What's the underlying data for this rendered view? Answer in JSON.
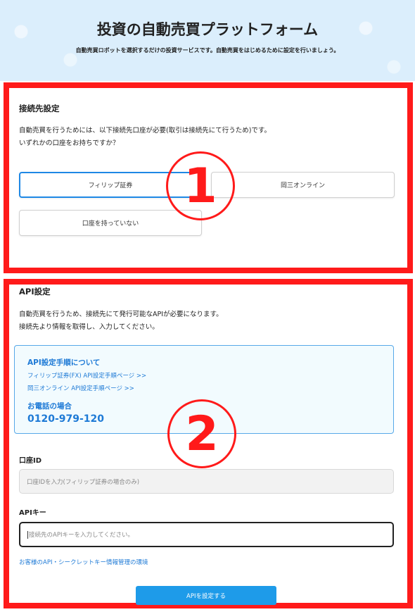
{
  "header": {
    "title": "投資の自動売買プラットフォーム",
    "subtitle": "自動売買ロボットを選択するだけの投資サービスです。自動売買をはじめるために設定を行いましょう。"
  },
  "connection": {
    "title": "接続先設定",
    "desc_line1": "自動売買を行うためには、以下接続先口座が必要(取引は接続先にて行うため)です。",
    "desc_line2": "いずれかの口座をお持ちですか？",
    "options": [
      {
        "label": "フィリップ証券",
        "selected": true
      },
      {
        "label": "岡三オンライン",
        "selected": false
      },
      {
        "label": "口座を持っていない",
        "selected": false
      }
    ],
    "marker": "1"
  },
  "api": {
    "title": "API設定",
    "desc_line1": "自動売買を行うため、接続先にて発行可能なAPIが必要になります。",
    "desc_line2": "接続先より情報を取得し、入力してください。",
    "info": {
      "title": "API設定手順について",
      "link1": "フィリップ証券(FX) API設定手順ページ >>",
      "link2": "岡三オンライン API設定手順ページ >>",
      "phone_title": "お電話の場合",
      "phone": "0120-979-120"
    },
    "account_label": "口座ID",
    "account_placeholder": "口座IDを入力(フィリップ証券の場合のみ)",
    "key_label": "APIキー",
    "key_placeholder": "接続先のAPIキーを入力してください。",
    "env_link": "お客様のAPI・シークレットキー情報管理の環境",
    "submit_label": "APIを設定する",
    "marker": "2"
  },
  "colors": {
    "accent": "#1e88e5",
    "highlight_border": "#ff1a1a",
    "header_bg": "#dbeefc"
  }
}
